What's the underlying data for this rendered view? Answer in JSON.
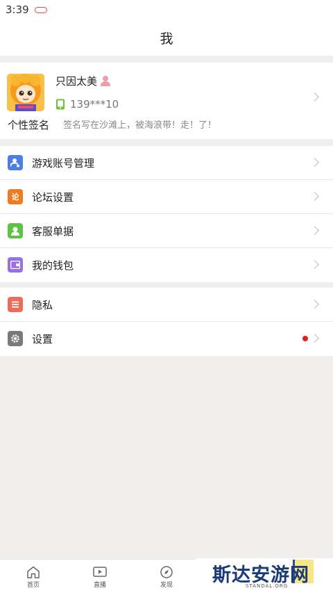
{
  "status_bar": {
    "time": "3:39"
  },
  "header": {
    "title": "我"
  },
  "profile": {
    "username": "只因太美",
    "phone": "139***10",
    "signature_label": "个性签名",
    "signature": "签名写在沙滩上，被海浪带！走！了！"
  },
  "menu_group_1": [
    {
      "label": "游戏账号管理",
      "icon": "account-icon",
      "color": "#4a7fe8"
    },
    {
      "label": "论坛设置",
      "icon": "forum-icon",
      "color": "#f07b1e"
    },
    {
      "label": "客服单据",
      "icon": "customer-service-icon",
      "color": "#5cc443"
    },
    {
      "label": "我的钱包",
      "icon": "wallet-icon",
      "color": "#9a6ee6"
    }
  ],
  "menu_group_2": [
    {
      "label": "隐私",
      "icon": "privacy-icon",
      "color": "#f06a5a"
    },
    {
      "label": "设置",
      "icon": "settings-icon",
      "color": "#7a7a7a",
      "badge_color": "#e41e1e"
    }
  ],
  "tab_bar": [
    {
      "label": "首页",
      "icon": "home-icon"
    },
    {
      "label": "直播",
      "icon": "live-icon"
    },
    {
      "label": "发现",
      "icon": "discover-icon"
    }
  ],
  "watermark": {
    "text": "斯达安游网",
    "sub": "STANDAL.ORG"
  }
}
